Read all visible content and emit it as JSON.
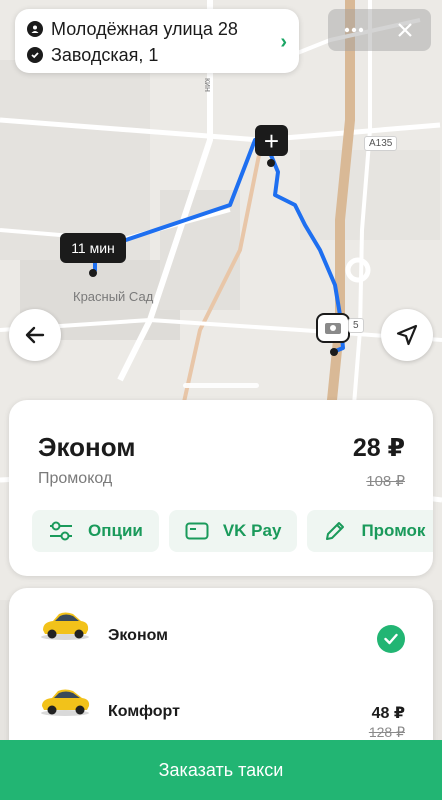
{
  "route": {
    "from": "Молодёжная улица 28",
    "to": "Заводская, 1"
  },
  "top_controls": {
    "more_icon": "more-dots-icon",
    "close_icon": "close-icon"
  },
  "map": {
    "place_label": "Красный Сад",
    "road_shield_1": "А135",
    "road_shield_2": "5",
    "road_label_vertical": "кин",
    "eta": "11 мин",
    "route_color": "#1e6ff0"
  },
  "tariff": {
    "title": "Эконом",
    "promo_label": "Промокод",
    "price": "28 ₽",
    "old_price": "108 ₽",
    "chips": [
      {
        "label": "Опции",
        "icon": "sliders-icon"
      },
      {
        "label": "VK Pay",
        "icon": "card-icon"
      },
      {
        "label": "Промок",
        "icon": "pencil-icon"
      }
    ]
  },
  "classes": [
    {
      "name": "Эконом",
      "selected": true,
      "price": "",
      "old_price": ""
    },
    {
      "name": "Комфорт",
      "selected": false,
      "price": "48 ₽",
      "old_price": "128 ₽"
    }
  ],
  "order_button": "Заказать такси",
  "colors": {
    "accent": "#22b573",
    "accent_text": "#1a9a5b",
    "chip_bg": "#eff6f2"
  }
}
